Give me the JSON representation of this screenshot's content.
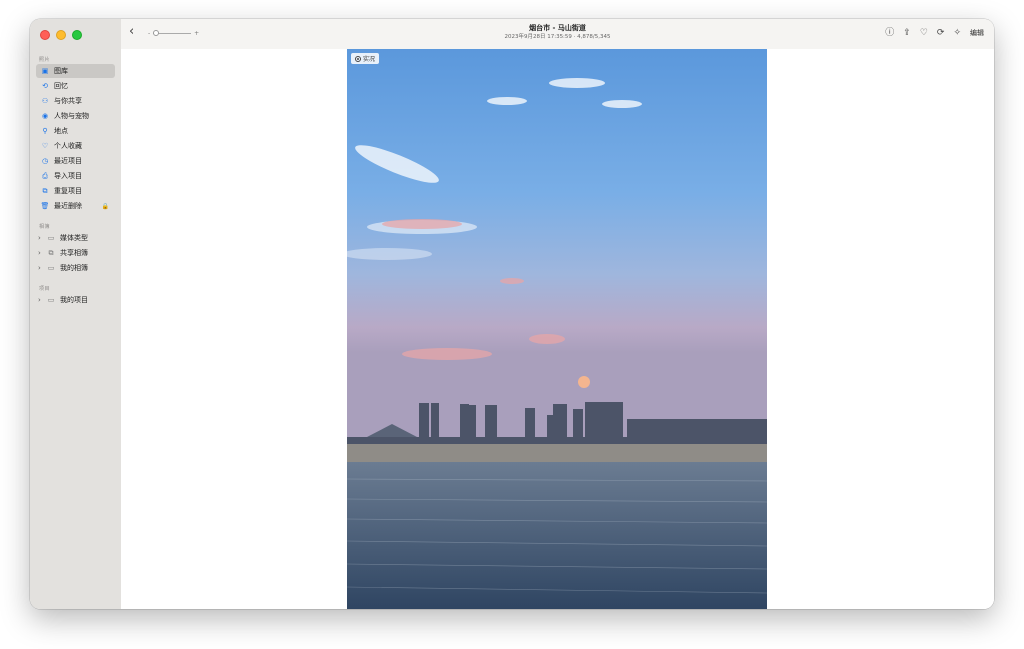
{
  "window": {
    "title": "烟台市 - 马山街道",
    "subtitle": "2023年9月28日 17:35:59 · 4,878/5,345"
  },
  "sidebar": {
    "sections": [
      {
        "label": "照片"
      },
      {
        "label": "相簿"
      },
      {
        "label": "项目"
      }
    ],
    "items": [
      {
        "label": "图库",
        "icon": "library-icon"
      },
      {
        "label": "回忆",
        "icon": "memories-icon"
      },
      {
        "label": "与你共享",
        "icon": "shared-with-you-icon"
      },
      {
        "label": "人物与宠物",
        "icon": "people-pets-icon"
      },
      {
        "label": "地点",
        "icon": "places-icon"
      },
      {
        "label": "个人收藏",
        "icon": "heart-icon"
      },
      {
        "label": "最近项目",
        "icon": "clock-icon"
      },
      {
        "label": "导入项目",
        "icon": "import-icon"
      },
      {
        "label": "重复项目",
        "icon": "duplicates-icon"
      },
      {
        "label": "最近删除",
        "icon": "trash-icon"
      }
    ],
    "albums": [
      {
        "label": "媒体类型"
      },
      {
        "label": "共享相簿"
      },
      {
        "label": "我的相簿"
      }
    ],
    "projects": [
      {
        "label": "我的项目"
      }
    ]
  },
  "toolbar": {
    "zoom_minus": "-",
    "zoom_plus": "+",
    "edit_label": "编辑"
  },
  "photo": {
    "live_label": "实况"
  },
  "colors": {
    "accent": "#1a73e8",
    "sidebar_bg": "#e3e1de",
    "selected_bg": "#cac8c5"
  }
}
